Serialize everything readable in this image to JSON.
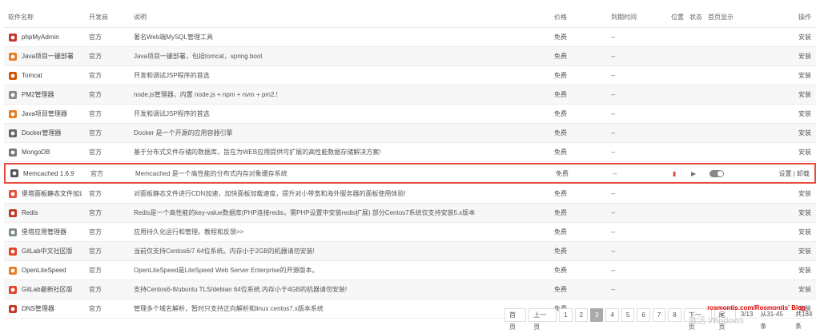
{
  "header": {
    "name": "软件名称",
    "dev": "开发商",
    "desc": "说明",
    "price": "价格",
    "expiry": "到期时间",
    "position": "位置",
    "status": "状态",
    "home": "首页显示",
    "ops": "操作"
  },
  "rows": [
    {
      "name": "phpMyAdmin",
      "dev": "官方",
      "desc": "著名Web端MySQL管理工具",
      "price": "免费",
      "expiry": "--",
      "ops": "安装",
      "icon": "phpmyadmin-icon",
      "color": "#c0392b"
    },
    {
      "name": "Java项目一键部署",
      "dev": "官方",
      "desc": "Java项目一键部署，包括tomcat，spring boot",
      "price": "免费",
      "expiry": "--",
      "ops": "安装",
      "icon": "java-icon",
      "color": "#e67e22"
    },
    {
      "name": "Tomcat",
      "dev": "官方",
      "desc": "开发和调试JSP程序的首选",
      "price": "免费",
      "expiry": "--",
      "ops": "安装",
      "icon": "tomcat-icon",
      "color": "#d35400"
    },
    {
      "name": "PM2管理器",
      "dev": "官方",
      "desc": "node.js管理器，内置 node.js + npm + nvm + pm2.!",
      "price": "免费",
      "expiry": "--",
      "ops": "安装",
      "icon": "pm2-icon",
      "color": "#888888"
    },
    {
      "name": "Java项目管理器",
      "dev": "官方",
      "desc": "开发和调试JSP程序的首选",
      "price": "免费",
      "expiry": "--",
      "ops": "安装",
      "icon": "java-icon",
      "color": "#e67e22"
    },
    {
      "name": "Docker管理器",
      "dev": "官方",
      "desc": "Docker 是一个开源的应用容器引擎",
      "price": "免费",
      "expiry": "--",
      "ops": "安装",
      "icon": "docker-icon",
      "color": "#666666"
    },
    {
      "name": "MongoDB",
      "dev": "官方",
      "desc": "基于分布式文件存储的数据库，旨在为WEB应用提供可扩展的高性能数据存储解决方案!",
      "price": "免费",
      "expiry": "--",
      "ops": "安装",
      "icon": "mongodb-icon",
      "color": "#777777"
    },
    {
      "name": "Memcached 1.6.9",
      "dev": "官方",
      "desc": "Memcached 是一个高性能的分布式内存对象缓存系统",
      "price": "免费",
      "expiry": "--",
      "ops": "设置 | 卸载",
      "icon": "memcached-icon",
      "color": "#555555",
      "highlight": true
    },
    {
      "name": "堡塔面板静态文件加速",
      "dev": "官方",
      "desc": "对面板静态文件进行CDN加速，加快面板加载速度，提升对小带宽和海外服务器的面板使用体验!",
      "price": "免费",
      "expiry": "--",
      "ops": "安装",
      "icon": "file-icon",
      "color": "#e74c3c"
    },
    {
      "name": "Redis",
      "dev": "官方",
      "desc": "Redis是一个高性能的key-value数据库(PHP连接redis，需PHP设置中安装redis扩展) 部分Centos7系统仅支持安装5.x版本",
      "price": "免费",
      "expiry": "--",
      "ops": "安装",
      "icon": "redis-icon",
      "color": "#c0392b"
    },
    {
      "name": "堡塔应用管理器",
      "dev": "官方",
      "desc": "应用持久化运行和管理。教程和反馈>>",
      "price": "免费",
      "expiry": "--",
      "ops": "安装",
      "icon": "app-manager-icon",
      "color": "#7f8c8d"
    },
    {
      "name": "GitLab中文社区版",
      "dev": "官方",
      "desc": "当前仅支持Centos6/7 64位系统。内存小于2GB的机器请勿安装!",
      "price": "免费",
      "expiry": "--",
      "ops": "安装",
      "icon": "gitlab-icon",
      "color": "#e24329"
    },
    {
      "name": "OpenLiteSpeed",
      "dev": "官方",
      "desc": "OpenLiteSpeed是LiteSpeed Web Server Enterprise的开源版本。",
      "price": "免费",
      "expiry": "--",
      "ops": "安装",
      "icon": "openlitespeed-icon",
      "color": "#e67e22"
    },
    {
      "name": "GitLab最新社区版",
      "dev": "官方",
      "desc": "支持Centos6-8/ubuntu TLS/debian 64位系统.内存小于4GB的机器请勿安装!",
      "price": "免费",
      "expiry": "--",
      "ops": "安装",
      "icon": "gitlab-icon",
      "color": "#e24329"
    },
    {
      "name": "DNS管理器",
      "dev": "官方",
      "desc": "管理多个域名解析，暂时只支持正向解析和linux centos7.x版本系统",
      "price": "免费",
      "expiry": "--",
      "ops": "安装",
      "icon": "dns-icon",
      "color": "#c0392b"
    }
  ],
  "pager": {
    "first": "首页",
    "prev": "上一页",
    "pages": [
      "1",
      "2",
      "3",
      "4",
      "5",
      "6",
      "7",
      "8"
    ],
    "current": "3",
    "next": "下一页",
    "last": "尾页",
    "page_info": "3/13",
    "range_info": "从31-45条",
    "total": "共184条"
  },
  "watermark": "rosmontis.com/Rosmontis' Blog",
  "watermark2": "激活 Windows"
}
